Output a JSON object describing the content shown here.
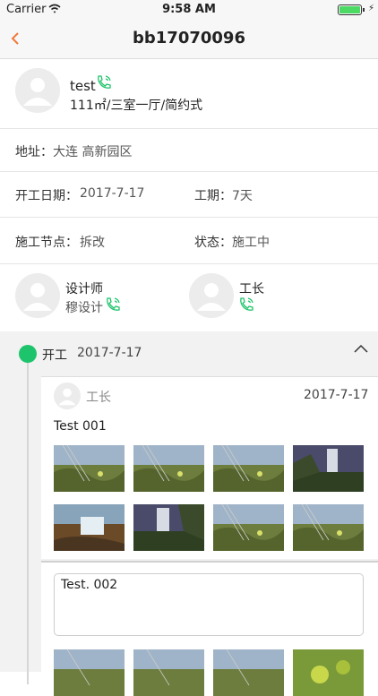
{
  "status_bar": {
    "carrier": "Carrier",
    "time": "9:58 AM"
  },
  "nav": {
    "title": "bb17070096"
  },
  "customer": {
    "name": "test",
    "house": "111㎡/三室一厅/简约式"
  },
  "address": {
    "label": "地址：",
    "value": "大连 高新园区"
  },
  "start_date": {
    "label": "开工日期：",
    "value": "2017-7-17"
  },
  "duration": {
    "label": "工期：",
    "value": "7天"
  },
  "stage": {
    "label": "施工节点：",
    "value": "拆改"
  },
  "status": {
    "label": "状态：",
    "value": "施工中"
  },
  "designer": {
    "role": "设计师",
    "name": "穆设计"
  },
  "foreman": {
    "role": "工长"
  },
  "timeline": {
    "stage_title": "开工",
    "stage_date": "2017-7-17",
    "entry1": {
      "author": "工长",
      "date": "2017-7-17",
      "text": "Test 001"
    },
    "entry2": {
      "text": "Test. 002"
    }
  }
}
